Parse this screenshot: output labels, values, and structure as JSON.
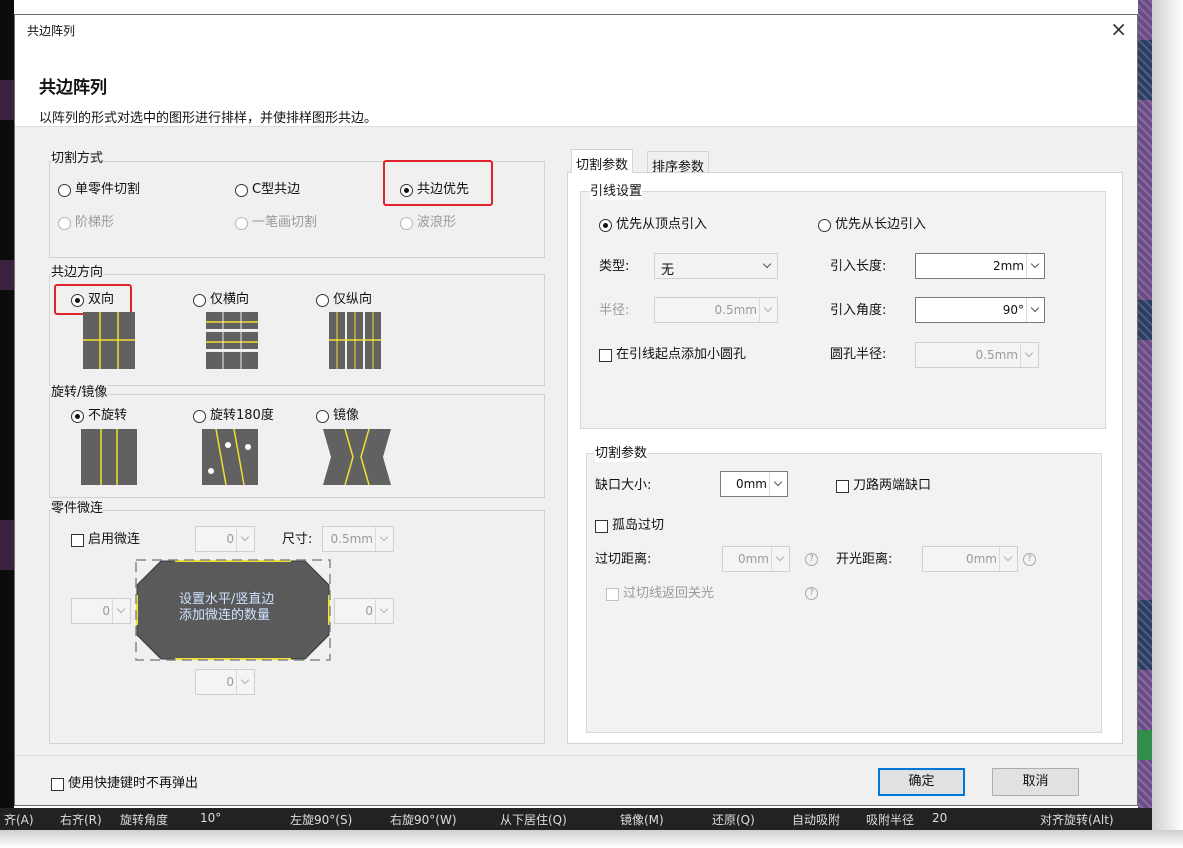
{
  "dialog": {
    "window_title": "共边阵列",
    "heading": "共边阵列",
    "description": "以阵列的形式对选中的图形进行排样，并使排样图形共边。",
    "close_icon": "close-icon"
  },
  "cut_mode": {
    "label": "切割方式",
    "options": [
      {
        "label": "单零件切割",
        "selected": false,
        "enabled": true
      },
      {
        "label": "C型共边",
        "selected": false,
        "enabled": true
      },
      {
        "label": "共边优先",
        "selected": true,
        "enabled": true
      },
      {
        "label": "阶梯形",
        "selected": false,
        "enabled": false
      },
      {
        "label": "一笔画切割",
        "selected": false,
        "enabled": false
      },
      {
        "label": "波浪形",
        "selected": false,
        "enabled": false
      }
    ]
  },
  "direction": {
    "label": "共边方向",
    "options": [
      {
        "label": "双向",
        "selected": true,
        "icon": "bidirectional-grid-icon"
      },
      {
        "label": "仅横向",
        "selected": false,
        "icon": "horizontal-only-grid-icon"
      },
      {
        "label": "仅纵向",
        "selected": false,
        "icon": "vertical-only-grid-icon"
      }
    ]
  },
  "rotation": {
    "label": "旋转/镜像",
    "options": [
      {
        "label": "不旋转",
        "selected": true,
        "icon": "no-rotation-icon"
      },
      {
        "label": "旋转180度",
        "selected": false,
        "icon": "rotate-180-icon"
      },
      {
        "label": "镜像",
        "selected": false,
        "icon": "mirror-icon"
      }
    ]
  },
  "micro_joint": {
    "label": "零件微连",
    "enable_label": "启用微连",
    "enabled": false,
    "count_value": "0",
    "size_label": "尺寸:",
    "size_value": "0.5mm",
    "left_value": "0",
    "right_value": "0",
    "bottom_value": "0",
    "diagram_text_line1": "设置水平/竖直边",
    "diagram_text_line2": "添加微连的数量",
    "accent_color": "#f0e030"
  },
  "tabs": [
    {
      "label": "切割参数",
      "active": true
    },
    {
      "label": "排序参数",
      "active": false
    }
  ],
  "lead": {
    "label": "引线设置",
    "from_vertex_label": "优先从顶点引入",
    "from_vertex_selected": true,
    "from_long_edge_label": "优先从长边引入",
    "from_long_edge_selected": false,
    "type_label": "类型:",
    "type_value": "无",
    "lead_length_label": "引入长度:",
    "lead_length_value": "2mm",
    "radius_label": "半径:",
    "radius_value": "0.5mm",
    "lead_angle_label": "引入角度:",
    "lead_angle_value": "90°",
    "add_hole_label": "在引线起点添加小圆孔",
    "add_hole_checked": false,
    "hole_radius_label": "圆孔半径:",
    "hole_radius_value": "0.5mm"
  },
  "cut_params": {
    "label": "切割参数",
    "gap_label": "缺口大小:",
    "gap_value": "0mm",
    "both_ends_gap_label": "刀路两端缺口",
    "both_ends_gap_checked": false,
    "island_overcut_label": "孤岛过切",
    "island_overcut_checked": false,
    "overcut_dist_label": "过切距离:",
    "overcut_dist_value": "0mm",
    "open_light_dist_label": "开光距离:",
    "open_light_dist_value": "0mm",
    "overcut_return_label": "过切线返回关光",
    "overcut_return_checked": false
  },
  "footer": {
    "no_popup_label": "使用快捷键时不再弹出",
    "no_popup_checked": false,
    "ok_label": "确定",
    "cancel_label": "取消"
  },
  "background_toolbar": {
    "items": [
      "齐(A)",
      "右齐(R)",
      "旋转角度",
      "10°",
      "左旋90°(S)",
      "右旋90°(W)",
      "从下居住(Q)",
      "镜像(M)",
      "还原(Q)",
      "自动吸附",
      "吸附半径",
      "20",
      "对齐旋转(Alt)"
    ]
  },
  "colors": {
    "highlight": "#e0242b",
    "primary_button_border": "#0078d7",
    "tile_fill": "#616161"
  }
}
